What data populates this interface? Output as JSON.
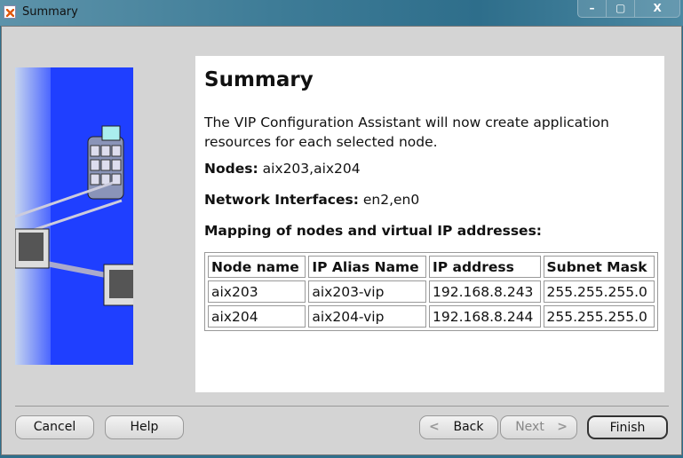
{
  "window": {
    "title": "Summary",
    "minimize": "–",
    "maximize": "▢",
    "close": "X"
  },
  "content": {
    "heading": "Summary",
    "intro": "The VIP Configuration Assistant will now create application resources for each selected node.",
    "nodes_label": "Nodes:",
    "nodes_value": "aix203,aix204",
    "interfaces_label": "Network Interfaces:",
    "interfaces_value": "en2,en0",
    "mapping_label": "Mapping of nodes and virtual IP addresses:",
    "table": {
      "headers": [
        "Node name",
        "IP Alias Name",
        "IP address",
        "Subnet Mask"
      ],
      "rows": [
        [
          "aix203",
          "aix203-vip",
          "192.168.8.243",
          "255.255.255.0"
        ],
        [
          "aix204",
          "aix204-vip",
          "192.168.8.244",
          "255.255.255.0"
        ]
      ]
    }
  },
  "buttons": {
    "cancel": "Cancel",
    "help": "Help",
    "back": "Back",
    "next": "Next",
    "finish": "Finish"
  }
}
